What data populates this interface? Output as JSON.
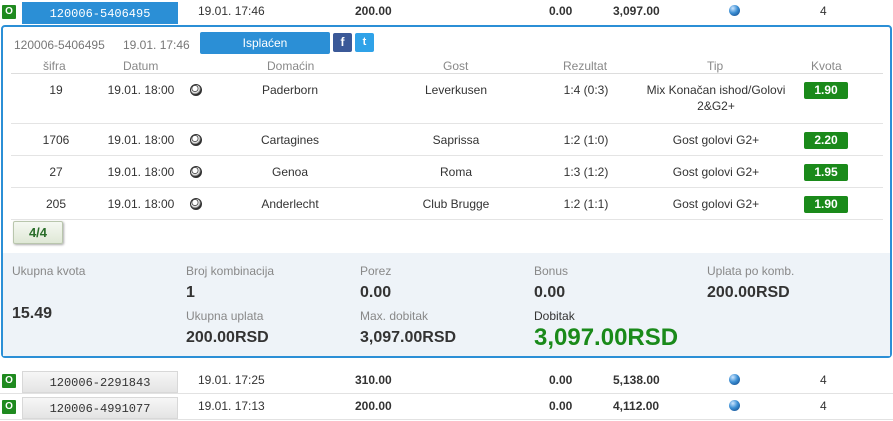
{
  "tickets": [
    {
      "badge": "O",
      "id": "120006-5406495",
      "date": "19.01. 17:46",
      "stake": "200.00",
      "zero": "0.00",
      "payout": "3,097.00",
      "count": "4"
    },
    {
      "badge": "O",
      "id": "120006-2291843",
      "date": "19.01. 17:25",
      "stake": "310.00",
      "zero": "0.00",
      "payout": "5,138.00",
      "count": "4"
    },
    {
      "badge": "O",
      "id": "120006-4991077",
      "date": "19.01. 17:13",
      "stake": "200.00",
      "zero": "0.00",
      "payout": "4,112.00",
      "count": "4"
    }
  ],
  "detail": {
    "id": "120006-5406495",
    "date": "19.01. 17:46",
    "status": "Isplaćen",
    "share": {
      "facebook": "f",
      "twitter": "t"
    },
    "columns": [
      "šifra",
      "Datum",
      "Domaćin",
      "Gost",
      "Rezultat",
      "Tip",
      "Kvota"
    ],
    "bets": [
      {
        "code": "19",
        "date": "19.01. 18:00",
        "home": "Paderborn",
        "away": "Leverkusen",
        "result": "1:4 (0:3)",
        "tip_line1": "Mix Konačan ishod/Golovi",
        "tip_line2": "2&G2+",
        "odd": "1.90"
      },
      {
        "code": "1706",
        "date": "19.01. 18:00",
        "home": "Cartagines",
        "away": "Saprissa",
        "result": "1:2 (1:0)",
        "tip_line1": "Gost golovi G2+",
        "tip_line2": "",
        "odd": "2.20"
      },
      {
        "code": "27",
        "date": "19.01. 18:00",
        "home": "Genoa",
        "away": "Roma",
        "result": "1:3 (1:2)",
        "tip_line1": "Gost golovi G2+",
        "tip_line2": "",
        "odd": "1.95"
      },
      {
        "code": "205",
        "date": "19.01. 18:00",
        "home": "Anderlecht",
        "away": "Club Brugge",
        "result": "1:2 (1:1)",
        "tip_line1": "Gost golovi G2+",
        "tip_line2": "",
        "odd": "1.90"
      }
    ],
    "fraction": "4/4",
    "summary": {
      "total_odds_label": "Ukupna kvota",
      "total_odds": "15.49",
      "combinations_label": "Broj kombinacija",
      "combinations": "1",
      "total_stake_label": "Ukupna uplata",
      "total_stake": "200.00RSD",
      "tax_label": "Porez",
      "tax": "0.00",
      "max_win_label": "Max. dobitak",
      "max_win": "3,097.00RSD",
      "bonus_label": "Bonus",
      "bonus": "0.00",
      "win_label": "Dobitak",
      "win": "3,097.00RSD",
      "stake_per_comb_label": "Uplata po komb.",
      "stake_per_comb": "200.00RSD"
    }
  },
  "colors": {
    "accent": "#2b8fd6",
    "odd_green": "#1a8a1a",
    "summary_bg": "#eef3f8"
  }
}
